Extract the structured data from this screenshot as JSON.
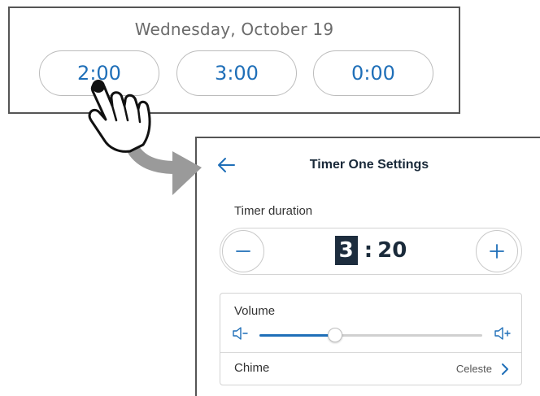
{
  "schedule": {
    "date": "Wednesday, October 19",
    "times": [
      "2:00",
      "3:00",
      "0:00"
    ]
  },
  "settings": {
    "title": "Timer One Settings",
    "duration_label": "Timer duration",
    "duration": {
      "minutes": "3",
      "separator": ":",
      "seconds": "20"
    },
    "volume_label": "Volume",
    "volume_level": 0.34,
    "chime_label": "Chime",
    "chime_value": "Celeste"
  },
  "colors": {
    "accent": "#1f6fb8",
    "dark": "#1d2d3e",
    "arrow": "#9a9a9a"
  }
}
